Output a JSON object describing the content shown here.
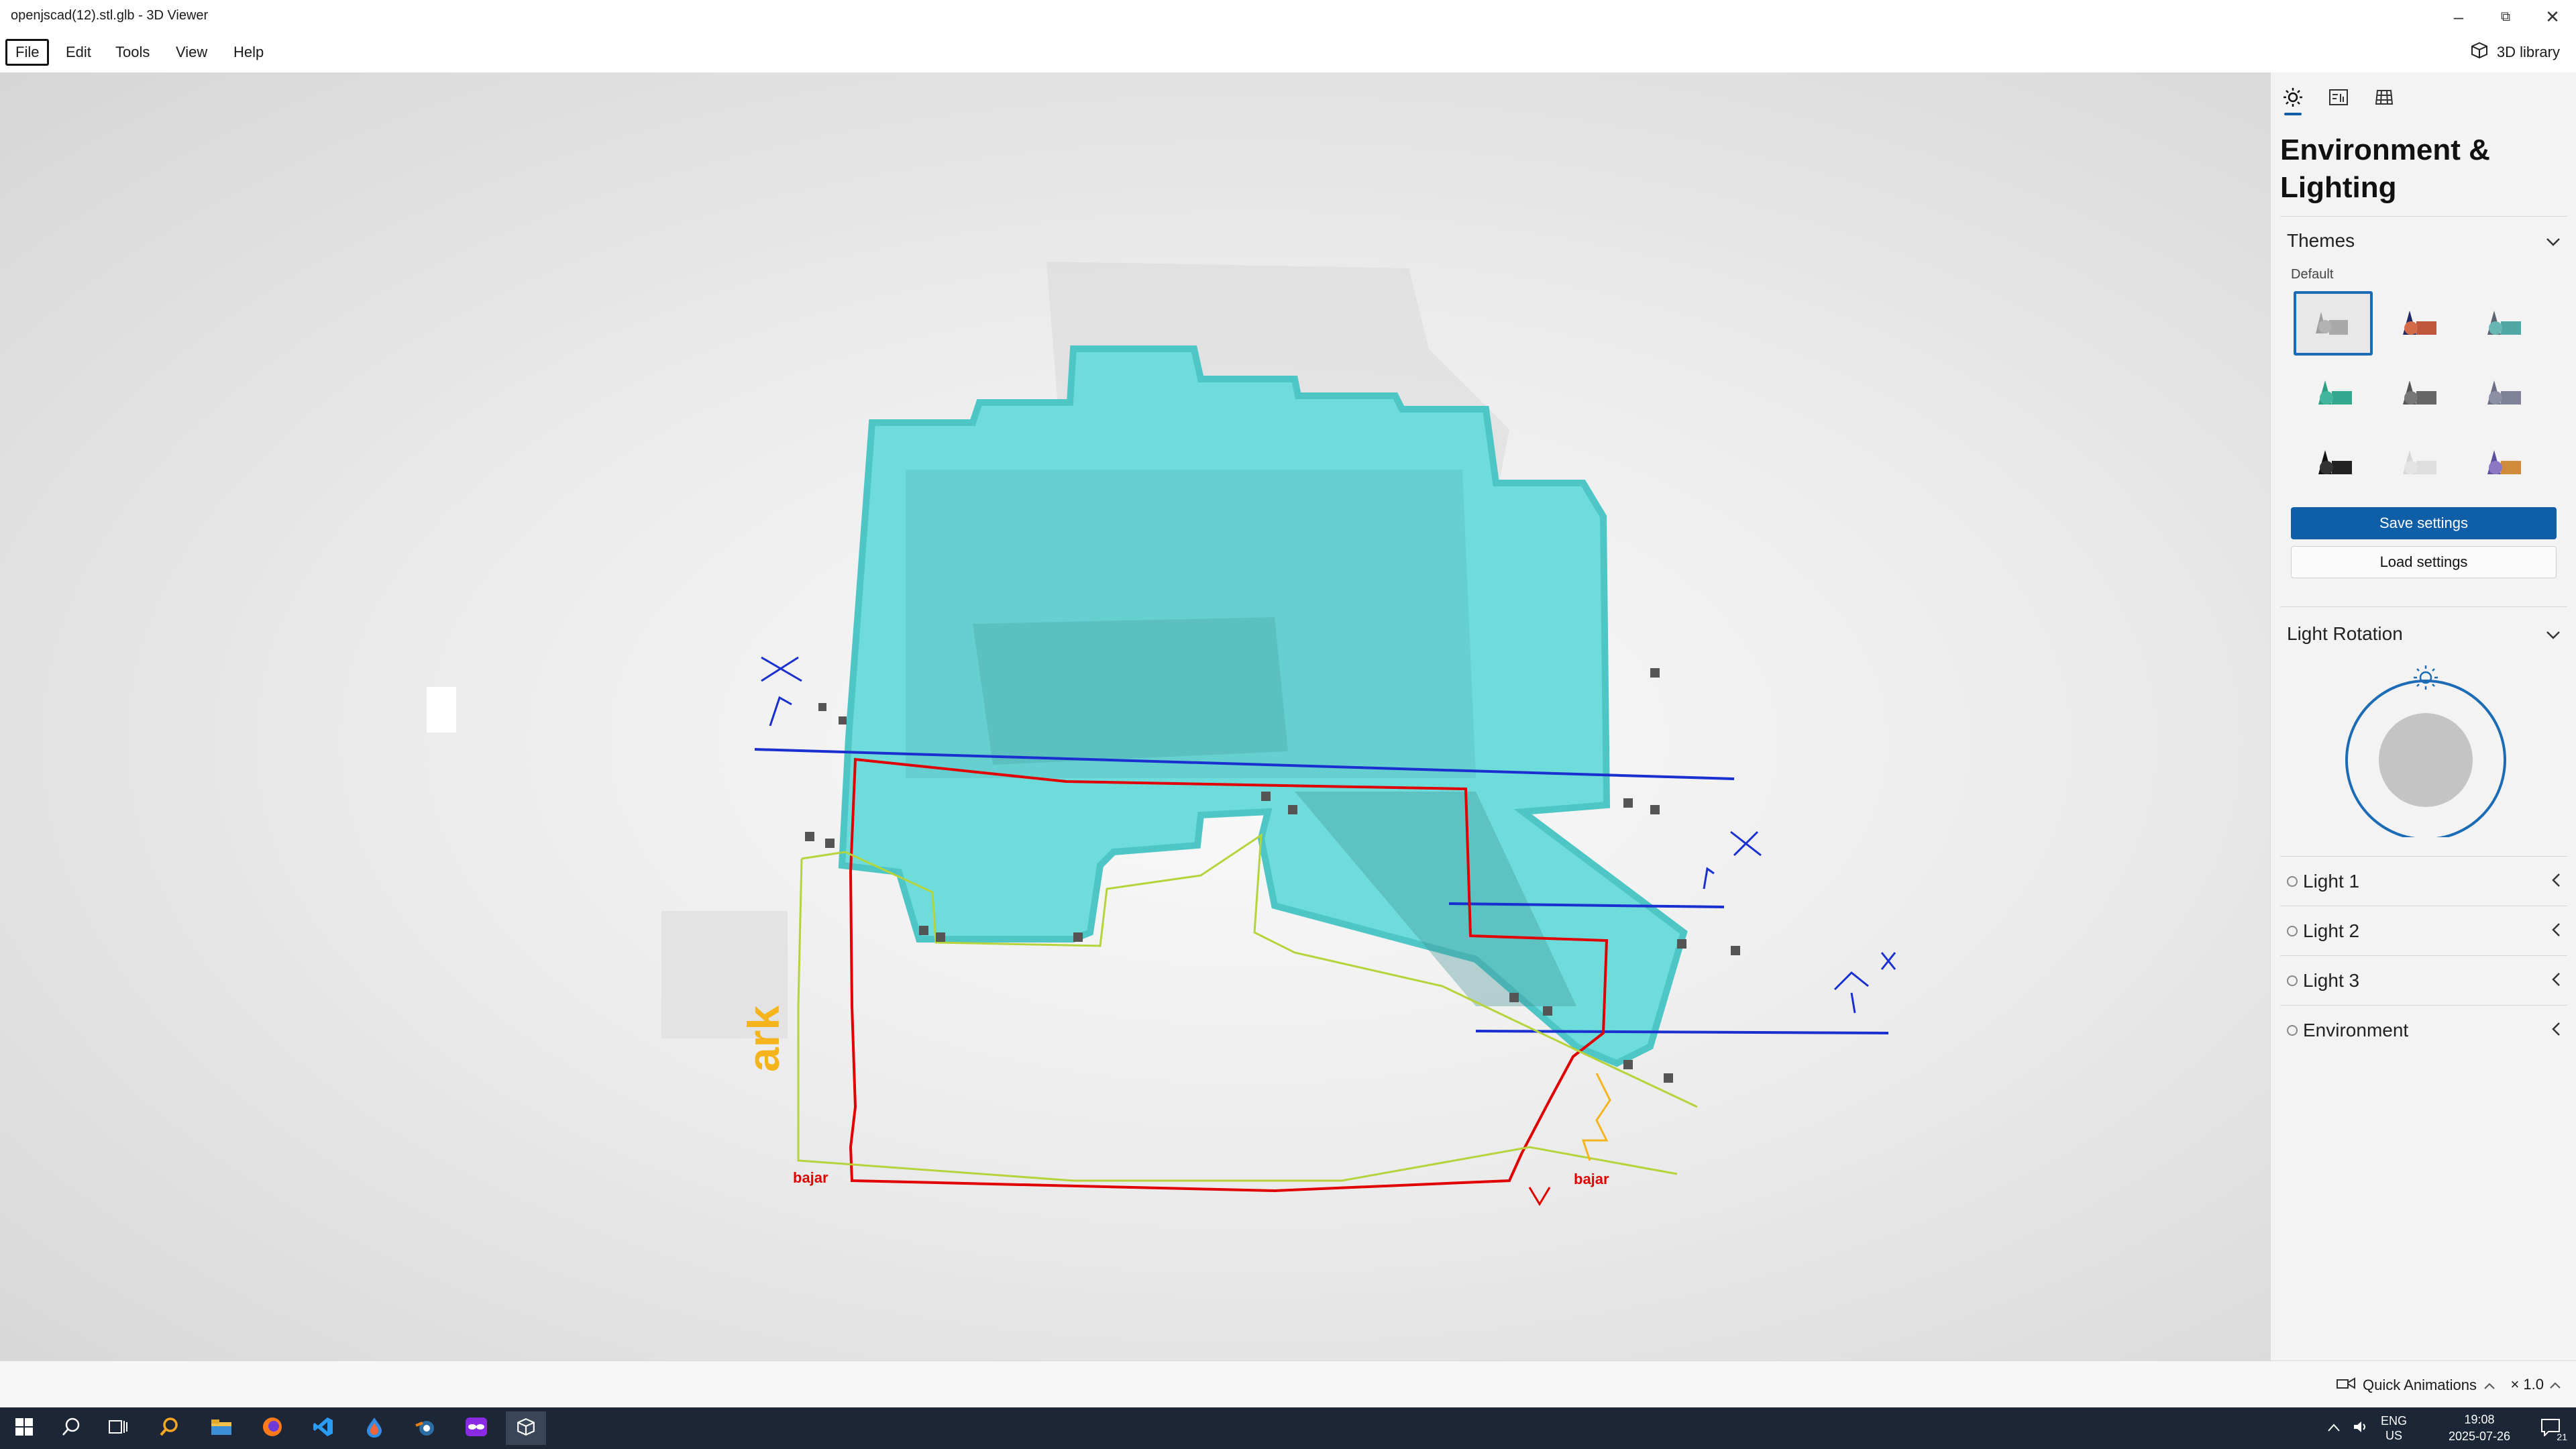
{
  "window": {
    "title": "openjscad(12).stl.glb - 3D Viewer"
  },
  "menu": {
    "file": "File",
    "edit": "Edit",
    "tools": "Tools",
    "view": "View",
    "help": "Help",
    "library": "3D library"
  },
  "viewport": {
    "annotations": {
      "bajar_left": "bajar",
      "bajar_right": "bajar",
      "ark": "ark"
    },
    "colors": {
      "model": "#6fdcdc",
      "red_ink": "#e00000",
      "blue_ink": "#1a2fcf",
      "green_ink": "#b5d33a",
      "orange_ink": "#f5b41c"
    }
  },
  "panel": {
    "title": "Environment & Lighting",
    "themes_header": "Themes",
    "default_label": "Default",
    "theme_count": 9,
    "save_settings": "Save settings",
    "load_settings": "Load settings",
    "light_rotation": "Light Rotation",
    "lights": [
      "Light 1",
      "Light 2",
      "Light 3",
      "Environment"
    ],
    "accent": "#0f5ea8"
  },
  "status": {
    "quick_animations": "Quick Animations",
    "zoom": "× 1.0"
  },
  "taskbar": {
    "lang": "ENG",
    "region": "US",
    "time": "19:08",
    "date": "2025-07-26",
    "notifications": "21"
  }
}
